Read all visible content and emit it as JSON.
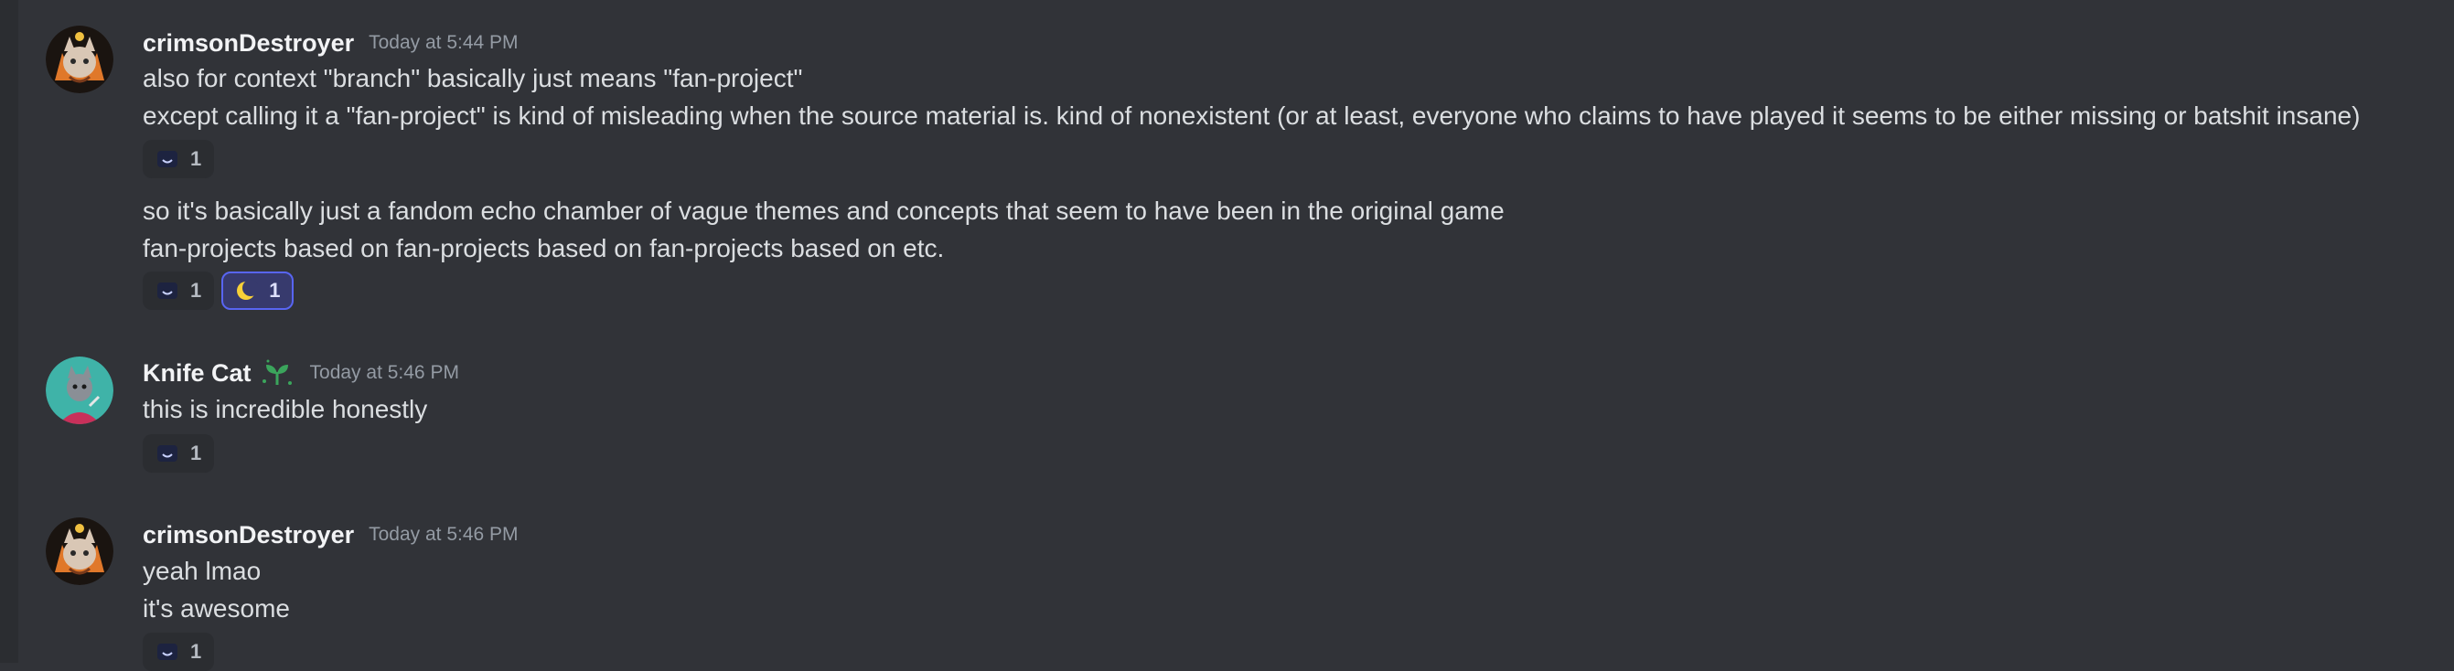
{
  "messages": [
    {
      "username": "crimsonDestroyer",
      "timestamp": "Today at 5:44 PM",
      "lines": [
        "also for context \"branch\" basically just means \"fan-project\"",
        "except calling it a \"fan-project\" is kind of misleading when the source material is. kind of nonexistent (or at least, everyone who claims to have played it seems to be either missing or batshit insane)"
      ],
      "reactions": [
        {
          "emoji": "dark-smile-emoji",
          "count": "1"
        }
      ],
      "followup_lines": [
        "so it's basically just a fandom echo chamber of vague themes and concepts that seem to have been in the original game",
        "fan-projects based on fan-projects based on fan-projects based on etc."
      ],
      "followup_reactions": [
        {
          "emoji": "dark-smile-emoji",
          "count": "1"
        },
        {
          "emoji": "crescent-moon-emoji",
          "count": "1"
        }
      ]
    },
    {
      "username": "Knife Cat",
      "badge_icon": "sprout-icon",
      "timestamp": "Today at 5:46 PM",
      "lines": [
        "this is incredible honestly"
      ],
      "reactions": [
        {
          "emoji": "dark-smile-emoji",
          "count": "1"
        }
      ]
    },
    {
      "username": "crimsonDestroyer",
      "timestamp": "Today at 5:46 PM",
      "lines": [
        "yeah lmao",
        "it's awesome"
      ],
      "reactions": [
        {
          "emoji": "dark-smile-emoji",
          "count": "1"
        }
      ]
    }
  ],
  "colors": {
    "background": "#313338",
    "reaction_background": "#2b2d31",
    "reaction_selected_border": "#5865f2",
    "username": "#f2f3f5",
    "timestamp": "#949ba4",
    "badge_green": "#3ba55c"
  }
}
